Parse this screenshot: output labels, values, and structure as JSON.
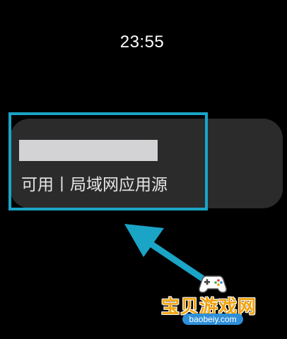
{
  "status_bar": {
    "time": "23:55"
  },
  "source_item": {
    "status_text": "可用丨局域网应用源"
  },
  "colors": {
    "highlight": "#1aa4c6",
    "card_bg": "#2b2b2b",
    "redaction": "#d3d3d5"
  },
  "watermark": {
    "title": "宝贝游戏网",
    "url": "baobeiy.com",
    "icon": "gamepad-icon"
  }
}
